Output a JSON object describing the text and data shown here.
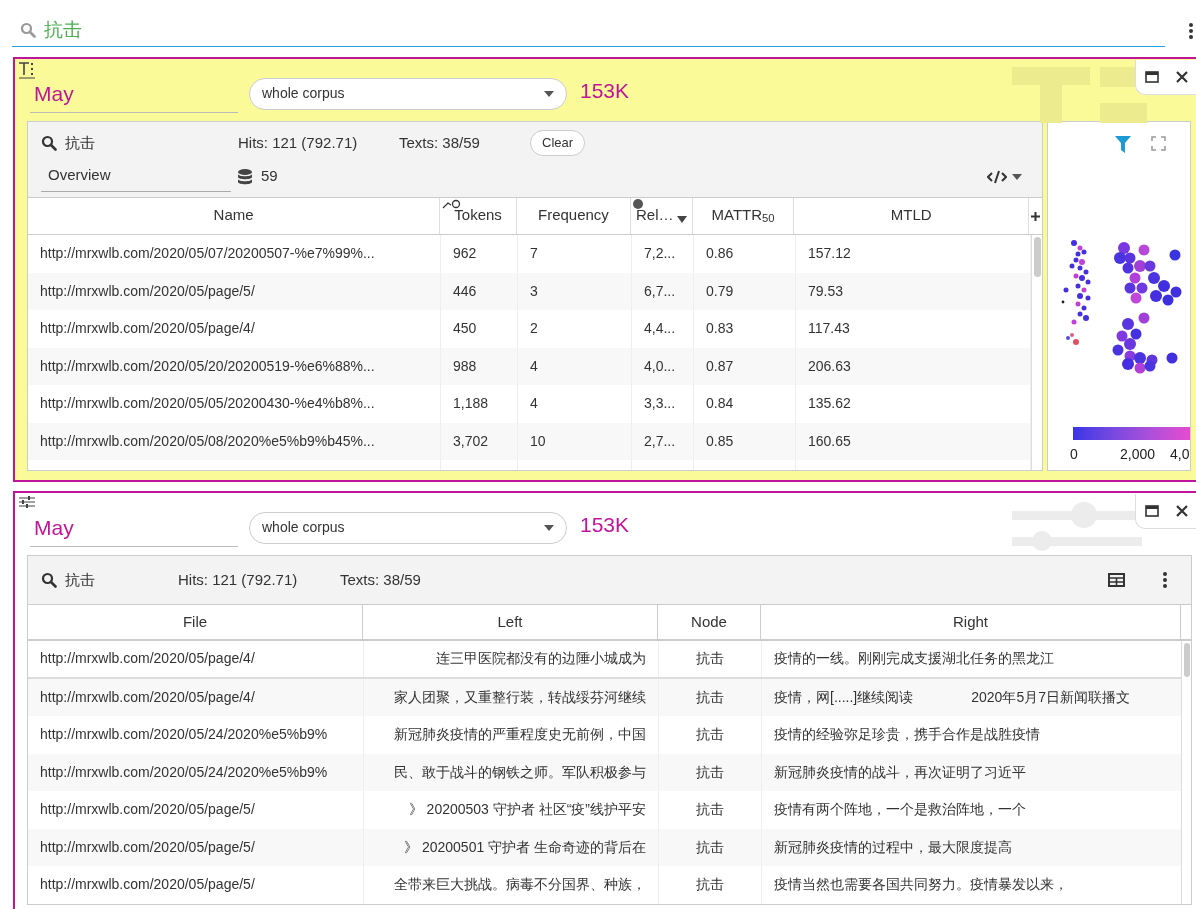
{
  "search": {
    "value": "抗击"
  },
  "panels": [
    {
      "kind": "overview",
      "title": "May",
      "scope": "whole corpus",
      "size": "153K",
      "query": "抗击",
      "hits_label": "Hits:",
      "hits": "121 (792.71)",
      "texts_label": "Texts:",
      "texts": "38/59",
      "clear_button": "Clear",
      "view": "Overview",
      "doc_count": "59",
      "columns": [
        "Name",
        "Tokens",
        "Frequency",
        "Rel…",
        "MATTR$_{50}$",
        "MTLD"
      ],
      "rows": [
        [
          "http://mrxwlb.com/2020/05/07/20200507-%e7%99%...",
          "962",
          "7",
          "7,2...",
          "0.86",
          "157.12"
        ],
        [
          "http://mrxwlb.com/2020/05/page/5/",
          "446",
          "3",
          "6,7...",
          "0.79",
          "79.53"
        ],
        [
          "http://mrxwlb.com/2020/05/page/4/",
          "450",
          "2",
          "4,4...",
          "0.83",
          "117.43"
        ],
        [
          "http://mrxwlb.com/2020/05/20/20200519-%e6%88%...",
          "988",
          "4",
          "4,0...",
          "0.87",
          "206.63"
        ],
        [
          "http://mrxwlb.com/2020/05/05/20200430-%e4%b8%...",
          "1,188",
          "4",
          "3,3...",
          "0.84",
          "135.62"
        ],
        [
          "http://mrxwlb.com/2020/05/08/2020%e5%b9%b45%...",
          "3,702",
          "10",
          "2,7...",
          "0.85",
          "160.65"
        ]
      ],
      "legend_ticks": [
        "0",
        "2,000",
        "4,0"
      ]
    },
    {
      "kind": "concordance",
      "title": "May",
      "scope": "whole corpus",
      "size": "153K",
      "query": "抗击",
      "hits_label": "Hits:",
      "hits": "121 (792.71)",
      "texts_label": "Texts:",
      "texts": "38/59",
      "columns": [
        "File",
        "Left",
        "Node",
        "Right"
      ],
      "rows": [
        {
          "file": "http://mrxwlb.com/2020/05/page/4/",
          "left": "连三甲医院都没有的边陲小城成为",
          "node": "抗击",
          "right": [
            "疫情的一线。刚刚完成支援湖北任务的黑龙江"
          ]
        },
        {
          "file": "http://mrxwlb.com/2020/05/page/4/",
          "left": "家人团聚，又重整行装，转战绥芬河继续",
          "node": "抗击",
          "right": [
            "疫情，网[.....]继续阅读",
            "2020年5月7日新闻联播文"
          ]
        },
        {
          "file": "http://mrxwlb.com/2020/05/24/2020%e5%b9%",
          "left": "新冠肺炎疫情的严重程度史无前例，中国",
          "node": "抗击",
          "right": [
            "疫情的经验弥足珍贵，携手合作是战胜疫情"
          ]
        },
        {
          "file": "http://mrxwlb.com/2020/05/24/2020%e5%b9%",
          "left": "民、敢于战斗的钢铁之师。军队积极参与",
          "node": "抗击",
          "right": [
            "新冠肺炎疫情的战斗，再次证明了习近平"
          ]
        },
        {
          "file": "http://mrxwlb.com/2020/05/page/5/",
          "left": "》 20200503 守护者 社区“疫”线护平安",
          "node": "抗击",
          "right": [
            "疫情有两个阵地，一个是救治阵地，一个"
          ]
        },
        {
          "file": "http://mrxwlb.com/2020/05/page/5/",
          "left": "》 20200501 守护者 生命奇迹的背后在",
          "node": "抗击",
          "right": [
            "新冠肺炎疫情的过程中，最大限度提高"
          ]
        },
        {
          "file": "http://mrxwlb.com/2020/05/page/5/",
          "left": "全带来巨大挑战。病毒不分国界、种族，",
          "node": "抗击",
          "right": [
            "疫情当然也需要各国共同努力。疫情暴发以来，"
          ]
        }
      ]
    }
  ]
}
